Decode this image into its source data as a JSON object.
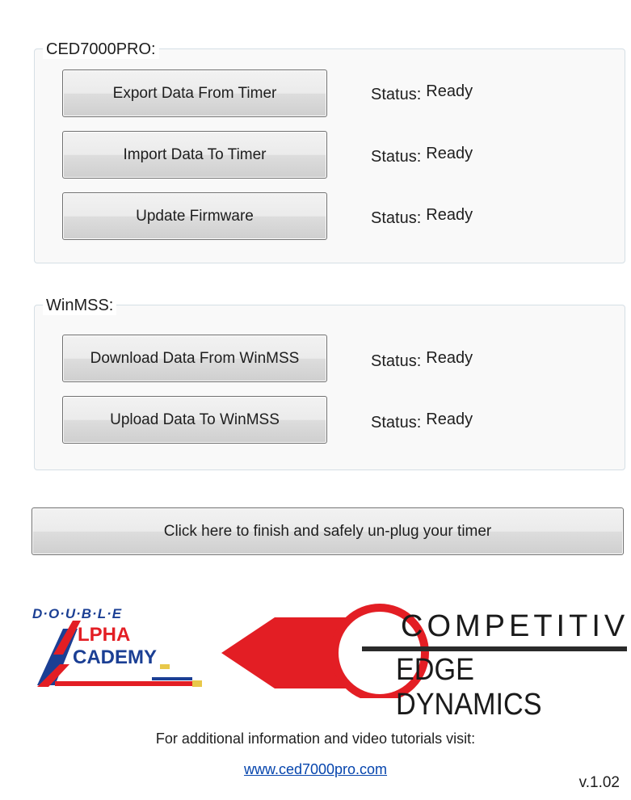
{
  "ced_group": {
    "title": "CED7000PRO:",
    "buttons": [
      {
        "label": "Export Data From Timer",
        "status_label": "Status:",
        "status_value": "Ready"
      },
      {
        "label": "Import Data To Timer",
        "status_label": "Status:",
        "status_value": "Ready"
      },
      {
        "label": "Update Firmware",
        "status_label": "Status:",
        "status_value": "Ready"
      }
    ]
  },
  "winmss_group": {
    "title": "WinMSS:",
    "buttons": [
      {
        "label": "Download Data From WinMSS",
        "status_label": "Status:",
        "status_value": "Ready"
      },
      {
        "label": "Upload Data To WinMSS",
        "status_label": "Status:",
        "status_value": "Ready"
      }
    ]
  },
  "finish_button": {
    "label": "Click here to finish and safely un-plug your timer"
  },
  "logos": {
    "alpha": {
      "top": "D·O·U·B·L·E",
      "line1": "LPHA",
      "line2": "CADEMY"
    },
    "ced": {
      "line1": "COMPETITIVE",
      "line2": "EDGE DYNAMICS"
    }
  },
  "footer": {
    "info_text": "For additional information and video tutorials visit:",
    "link_text": "www.ced7000pro.com",
    "version": "v.1.02"
  },
  "colors": {
    "logo_red": "#e31e24",
    "logo_blue": "#1b3f94",
    "link_blue": "#0645ad"
  }
}
